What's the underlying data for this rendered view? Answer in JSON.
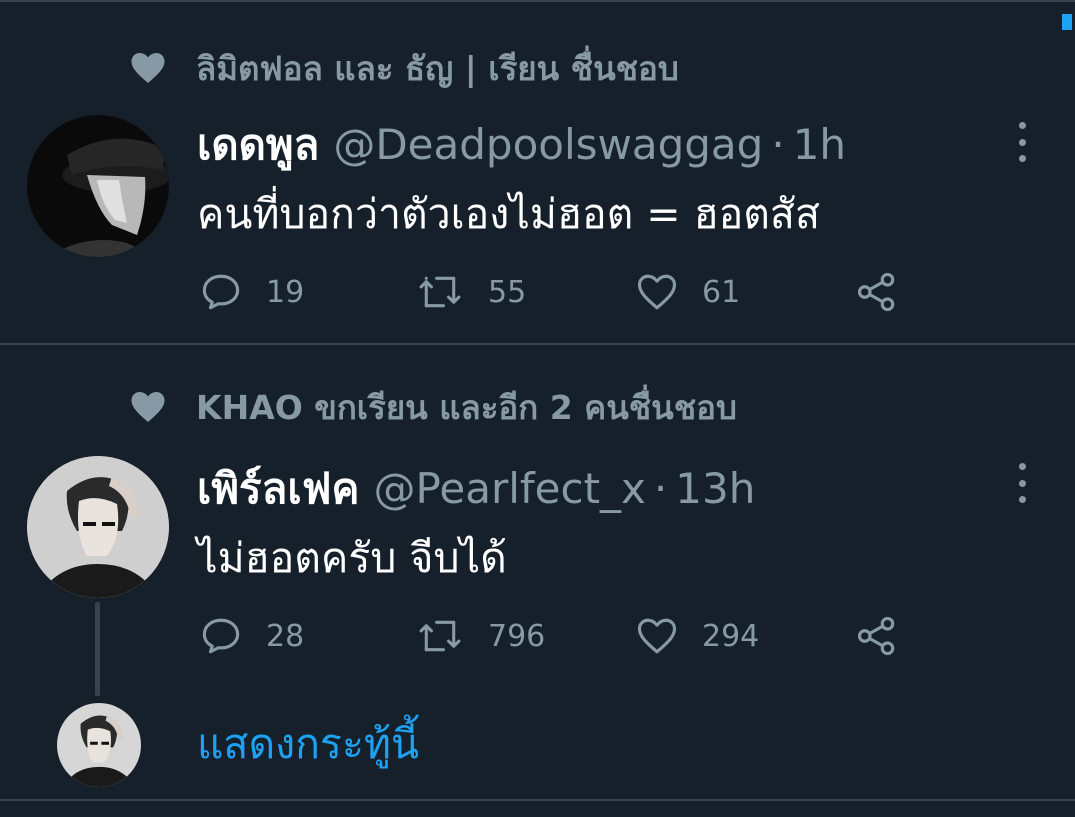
{
  "tweets": [
    {
      "social_context": "ลิมิตฟอล และ ธัญ | เรียน ชื่นชอบ",
      "display_name": "เดดพูล",
      "handle": "@Deadpoolswaggag",
      "separator": "·",
      "time": "1h",
      "text": "คนที่บอกว่าตัวเองไม่ฮอต = ฮอตสัส",
      "reply_count": "19",
      "retweet_count": "55",
      "like_count": "61"
    },
    {
      "social_context": "KHAO ขกเรียน และอีก 2 คนชื่นชอบ",
      "display_name": "เพิร์ลเฟค",
      "handle": "@Pearlfect_x",
      "separator": "·",
      "time": "13h",
      "text": "ไม่ฮอตครับ จีบได้",
      "reply_count": "28",
      "retweet_count": "796",
      "like_count": "294"
    }
  ],
  "thread": {
    "show_thread_label": "แสดงกระทู้นี้"
  },
  "colors": {
    "background": "#15202b",
    "text_primary": "#ffffff",
    "text_secondary": "#8899a6",
    "accent": "#1da1f2",
    "divider": "#38444d"
  },
  "icons": [
    "heart-icon",
    "reply-icon",
    "retweet-icon",
    "like-icon",
    "share-icon",
    "more-icon"
  ]
}
